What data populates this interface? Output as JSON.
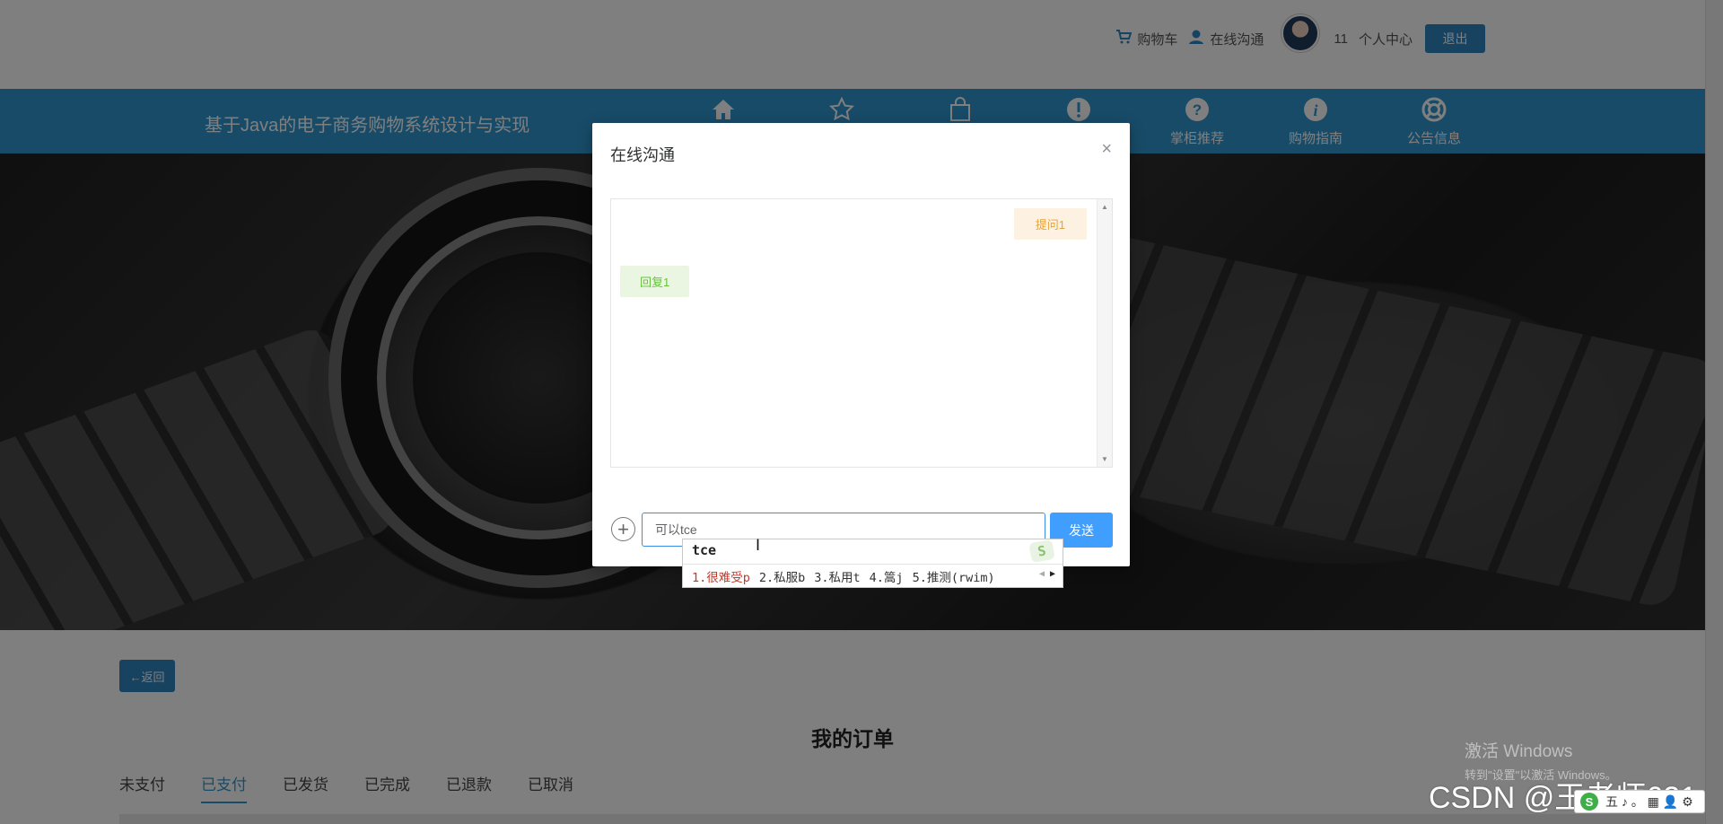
{
  "header": {
    "links": [
      {
        "label": "购物车",
        "icon": "cart-icon"
      },
      {
        "label": "在线沟通",
        "icon": "user-chat-icon"
      }
    ],
    "username": "11",
    "personal_center": "个人中心",
    "logout_label": "退出"
  },
  "nav": {
    "site_title": "基于Java的电子商务购物系统设计与实现",
    "items": [
      {
        "label": "",
        "icon": "home-icon"
      },
      {
        "label": "",
        "icon": "star-icon"
      },
      {
        "label": "",
        "icon": "shopping-bag-icon"
      },
      {
        "label": "",
        "icon": "exclamation-icon"
      },
      {
        "label": "掌柜推荐",
        "icon": "question-icon"
      },
      {
        "label": "购物指南",
        "icon": "info-icon"
      },
      {
        "label": "公告信息",
        "icon": "lifebuoy-icon"
      }
    ]
  },
  "content": {
    "back_label": "←返回",
    "orders_title": "我的订单",
    "tabs": [
      "未支付",
      "已支付",
      "已发货",
      "已完成",
      "已退款",
      "已取消"
    ],
    "active_tab": "已支付"
  },
  "dialog": {
    "title": "在线沟通",
    "close": "×",
    "messages": [
      {
        "side": "right",
        "text": "提问1"
      },
      {
        "side": "left",
        "text": "回复1"
      }
    ],
    "input_value": "可以tce",
    "send_label": "发送"
  },
  "ime": {
    "composition": "tce",
    "candidates": [
      "1.很难受p",
      "2.私服b",
      "3.私用t",
      "4.篙j",
      "5.推测(rwim)"
    ],
    "logo": "S"
  },
  "watermarks": {
    "windows_line1": "激活 Windows",
    "windows_line2": "转到\"设置\"以激活 Windows。",
    "csdn": "CSDN @王老师621",
    "taskbar_ime": "五 ♪ 。 ▦ 👤 ⚙"
  },
  "colors": {
    "nav_blue": "#3197d1",
    "primary_button": "#409eff",
    "question_bg": "#fdf2e2",
    "reply_bg": "#eaf6e1"
  }
}
